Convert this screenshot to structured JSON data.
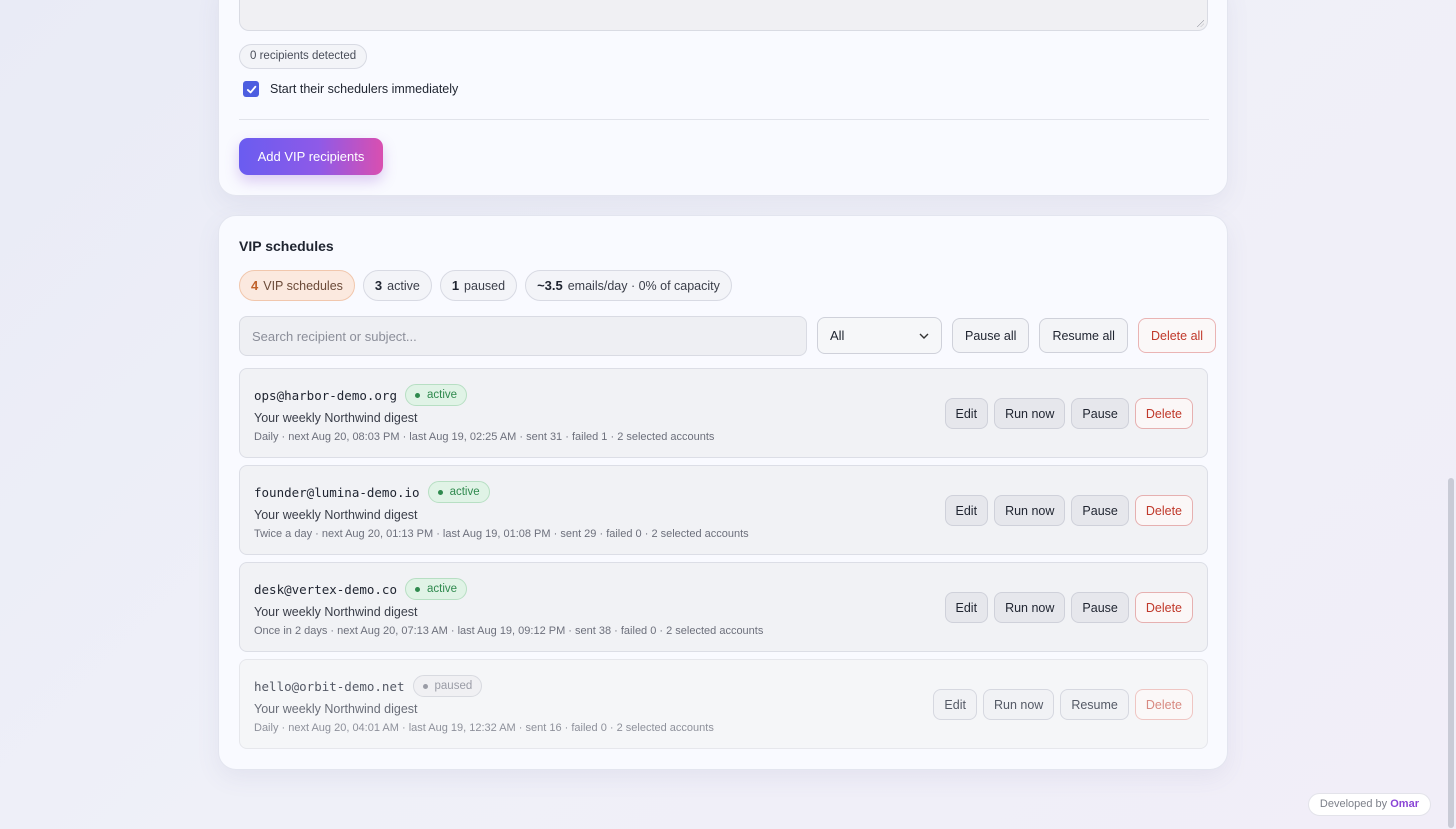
{
  "form": {
    "recipients_detected": "0 recipients detected",
    "start_immediately_label": "Start their schedulers immediately",
    "start_immediately_checked": true,
    "add_button": "Add VIP recipients"
  },
  "schedules": {
    "title": "VIP schedules",
    "stats": [
      {
        "value": "4",
        "label": "VIP schedules"
      },
      {
        "value": "3",
        "label": "active"
      },
      {
        "value": "1",
        "label": "paused"
      },
      {
        "value": "~3.5",
        "label": "emails/day · 0% of capacity"
      }
    ],
    "search_placeholder": "Search recipient or subject...",
    "filter_value": "All",
    "pause_all": "Pause all",
    "resume_all": "Resume all",
    "delete_all": "Delete all",
    "rows": [
      {
        "email": "ops@harbor-demo.org",
        "status": "active",
        "subject": "Your weekly Northwind digest",
        "meta": "Daily · next Aug 20, 08:03 PM · last Aug 19, 02:25 AM · sent 31 · failed 1 · 2 selected accounts",
        "edit": "Edit",
        "run": "Run now",
        "toggle": "Pause",
        "delete": "Delete"
      },
      {
        "email": "founder@lumina-demo.io",
        "status": "active",
        "subject": "Your weekly Northwind digest",
        "meta": "Twice a day · next Aug 20, 01:13 PM · last Aug 19, 01:08 PM · sent 29 · failed 0 · 2 selected accounts",
        "edit": "Edit",
        "run": "Run now",
        "toggle": "Pause",
        "delete": "Delete"
      },
      {
        "email": "desk@vertex-demo.co",
        "status": "active",
        "subject": "Your weekly Northwind digest",
        "meta": "Once in 2 days · next Aug 20, 07:13 AM · last Aug 19, 09:12 PM · sent 38 · failed 0 · 2 selected accounts",
        "edit": "Edit",
        "run": "Run now",
        "toggle": "Pause",
        "delete": "Delete"
      },
      {
        "email": "hello@orbit-demo.net",
        "status": "paused",
        "subject": "Your weekly Northwind digest",
        "meta": "Daily · next Aug 20, 04:01 AM · last Aug 19, 12:32 AM · sent 16 · failed 0 · 2 selected accounts",
        "edit": "Edit",
        "run": "Run now",
        "toggle": "Resume",
        "delete": "Delete"
      }
    ]
  },
  "footer": {
    "developed_by": "Developed by",
    "author": "Omar"
  },
  "colors": {
    "accent": "#4d5ee0",
    "active_green": "#2f8a4e",
    "danger_red": "#c0392b",
    "stat_orange": "#c0622b",
    "author_purple": "#8a45d6"
  }
}
